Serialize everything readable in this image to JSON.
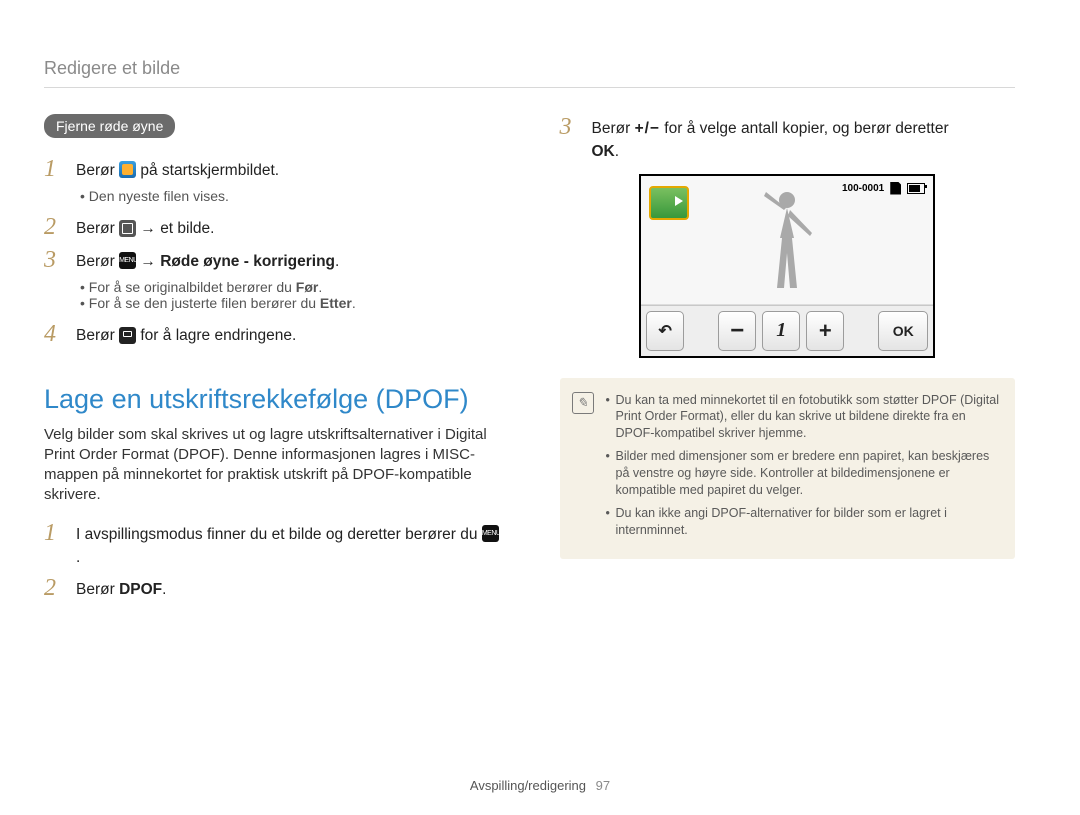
{
  "breadcrumb": "Redigere et bilde",
  "left": {
    "tag": "Fjerne røde øyne",
    "steps": {
      "s1_a": "Berør ",
      "s1_b": " på startskjermbildet.",
      "s1_bullet1": "Den nyeste filen vises.",
      "s2_a": "Berør ",
      "s2_arrow": " → ",
      "s2_b": "et bilde.",
      "s3_a": "Berør ",
      "s3_arrow": " → ",
      "s3_bold": "Røde øyne - korrigering",
      "s3_end": ".",
      "s3_bullet1_a": "For å se originalbildet berører du ",
      "s3_bullet1_b": "Før",
      "s3_bullet1_c": ".",
      "s3_bullet2_a": "For å se den justerte filen berører du ",
      "s3_bullet2_b": "Etter",
      "s3_bullet2_c": ".",
      "s4_a": "Berør ",
      "s4_b": " for å lagre endringene."
    },
    "section_title": "Lage en utskriftsrekkefølge (DPOF)",
    "section_para": "Velg bilder som skal skrives ut og lagre utskriftsalternativer i Digital Print Order Format (DPOF). Denne informasjonen lagres i MISC-mappen på minnekortet for praktisk utskrift på DPOF-kompatible skrivere.",
    "d1_a": "I avspillingsmodus finner du et bilde og deretter berører du ",
    "d1_b": ".",
    "d2_a": "Berør ",
    "d2_bold": "DPOF",
    "d2_b": "."
  },
  "right": {
    "s3_a": "Berør ",
    "s3_pm": "+/−",
    "s3_b": " for å velge antall kopier, og berør deretter ",
    "s3_ok": "OK",
    "screen": {
      "counter_label": "100-0001",
      "count_value": "1",
      "minus": "−",
      "plus": "+",
      "ok": "OK"
    },
    "notes": {
      "n1": "Du kan ta med minnekortet til en fotobutikk som støtter DPOF (Digital Print Order Format), eller du kan skrive ut bildene direkte fra en DPOF-kompatibel skriver hjemme.",
      "n2": "Bilder med dimensjoner som er bredere enn papiret, kan beskjæres på venstre og høyre side. Kontroller at bildedimensjonene er kompatible med papiret du velger.",
      "n3": "Du kan ikke angi DPOF-alternativer for bilder som er lagret i internminnet."
    }
  },
  "footer": {
    "section": "Avspilling/redigering",
    "page": "97"
  }
}
